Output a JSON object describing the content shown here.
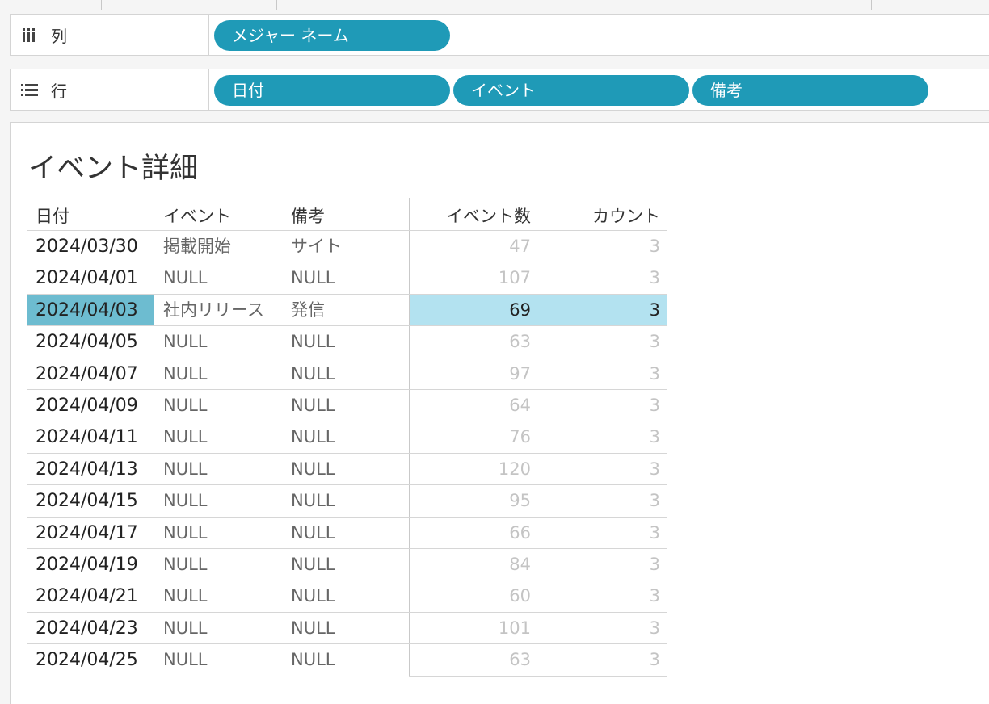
{
  "shelves": {
    "columns": {
      "label": "列",
      "icon": "columns-icon",
      "pills": [
        "メジャー ネーム"
      ]
    },
    "rows": {
      "label": "行",
      "icon": "rows-icon",
      "pills": [
        "日付",
        "イベント",
        "備考"
      ]
    }
  },
  "colors": {
    "pill": "#1f9ab7",
    "selected_header": "#6dbcd0",
    "selected_measure": "#b3e2f0"
  },
  "view": {
    "title": "イベント詳細",
    "headers": {
      "date": "日付",
      "event": "イベント",
      "note": "備考",
      "event_count": "イベント数",
      "count": "カウント"
    },
    "selected_row_index": 2,
    "rows": [
      {
        "date": "2024/03/30",
        "event": "掲載開始",
        "note": "サイト",
        "event_count": "47",
        "count": "3"
      },
      {
        "date": "2024/04/01",
        "event": "NULL",
        "note": "NULL",
        "event_count": "107",
        "count": "3"
      },
      {
        "date": "2024/04/03",
        "event": "社内リリース",
        "note": "発信",
        "event_count": "69",
        "count": "3"
      },
      {
        "date": "2024/04/05",
        "event": "NULL",
        "note": "NULL",
        "event_count": "63",
        "count": "3"
      },
      {
        "date": "2024/04/07",
        "event": "NULL",
        "note": "NULL",
        "event_count": "97",
        "count": "3"
      },
      {
        "date": "2024/04/09",
        "event": "NULL",
        "note": "NULL",
        "event_count": "64",
        "count": "3"
      },
      {
        "date": "2024/04/11",
        "event": "NULL",
        "note": "NULL",
        "event_count": "76",
        "count": "3"
      },
      {
        "date": "2024/04/13",
        "event": "NULL",
        "note": "NULL",
        "event_count": "120",
        "count": "3"
      },
      {
        "date": "2024/04/15",
        "event": "NULL",
        "note": "NULL",
        "event_count": "95",
        "count": "3"
      },
      {
        "date": "2024/04/17",
        "event": "NULL",
        "note": "NULL",
        "event_count": "66",
        "count": "3"
      },
      {
        "date": "2024/04/19",
        "event": "NULL",
        "note": "NULL",
        "event_count": "84",
        "count": "3"
      },
      {
        "date": "2024/04/21",
        "event": "NULL",
        "note": "NULL",
        "event_count": "60",
        "count": "3"
      },
      {
        "date": "2024/04/23",
        "event": "NULL",
        "note": "NULL",
        "event_count": "101",
        "count": "3"
      },
      {
        "date": "2024/04/25",
        "event": "NULL",
        "note": "NULL",
        "event_count": "63",
        "count": "3"
      }
    ]
  }
}
